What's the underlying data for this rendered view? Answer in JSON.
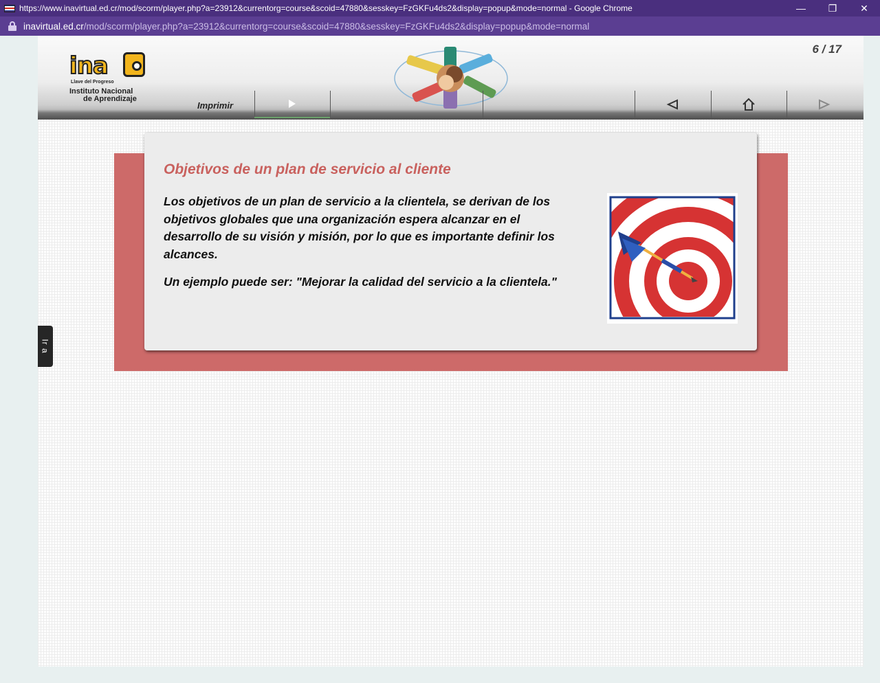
{
  "window": {
    "title": "https://www.inavirtual.ed.cr/mod/scorm/player.php?a=23912&currentorg=course&scoid=47880&sesskey=FzGKFu4ds2&display=popup&mode=normal - Google Chrome",
    "url_host": "inavirtual.ed.cr",
    "url_path": "/mod/scorm/player.php?a=23912&currentorg=course&scoid=47880&sesskey=FzGKFu4ds2&display=popup&mode=normal",
    "minimize_glyph": "—",
    "restore_glyph": "❐",
    "close_glyph": "✕"
  },
  "header": {
    "logo_word": "ina",
    "logo_slogan": "Llave del Progreso",
    "logo_name_line1": "Instituto Nacional",
    "logo_name_line2": "de Aprendizaje",
    "page_counter": "6 / 17"
  },
  "nav": {
    "print_label": "Imprimir",
    "icons": [
      "play-icon",
      "back-arrow-icon",
      "home-icon",
      "forward-arrow-icon"
    ]
  },
  "content": {
    "title": "Objetivos de un plan de servicio al cliente",
    "paragraph": "Los objetivos de un plan de servicio a la clientela, se derivan de los objetivos globales que una organización espera alcanzar en el desarrollo de su visión y misión, por lo que es importante definir los alcances.",
    "example": "Un ejemplo puede ser: \"Mejorar la calidad del servicio a la clientela.\""
  },
  "side_tab": {
    "label": "Ir a"
  },
  "colors": {
    "title_bar": "#4a2f7e",
    "address_bar": "#5b3e92",
    "accent_red": "#cd6a69",
    "title_red": "#c9615e",
    "logo_yellow": "#f2b51d"
  }
}
